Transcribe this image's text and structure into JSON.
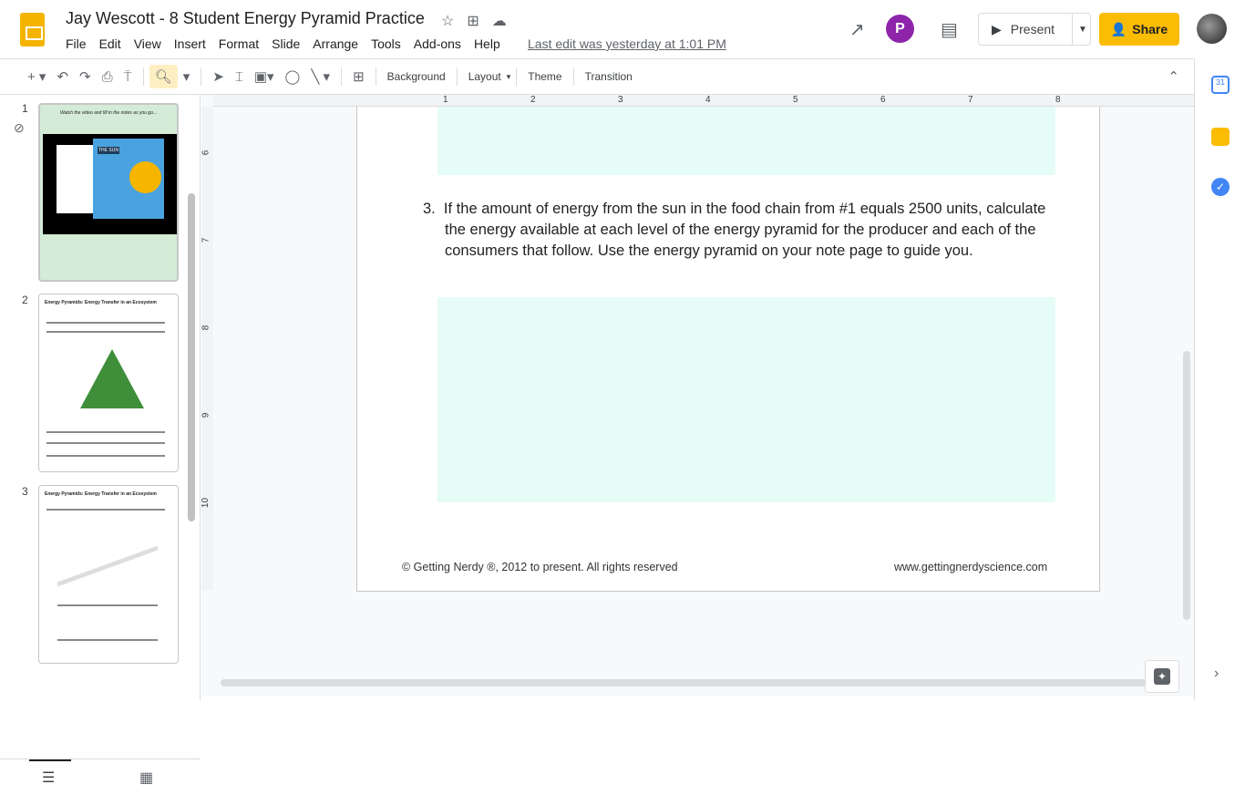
{
  "header": {
    "title": "Jay Wescott - 8 Student Energy Pyramid Practice",
    "last_edit": "Last edit was yesterday at 1:01 PM",
    "present": "Present",
    "share": "Share"
  },
  "menu": [
    "File",
    "Edit",
    "View",
    "Insert",
    "Format",
    "Slide",
    "Arrange",
    "Tools",
    "Add-ons",
    "Help"
  ],
  "toolbar": {
    "background": "Background",
    "layout": "Layout",
    "theme": "Theme",
    "transition": "Transition"
  },
  "slides": [
    {
      "number": "1",
      "heading": "Watch the video and fill in the notes as you go...",
      "label": "THE SUN"
    },
    {
      "number": "2",
      "heading": "Energy Pyramids: Energy Transfer in an Ecosystem"
    },
    {
      "number": "3",
      "heading": "Energy Pyramids: Energy Transfer in an Ecosystem"
    }
  ],
  "ruler": {
    "h": [
      "1",
      "2",
      "3",
      "4",
      "5",
      "6",
      "7",
      "8"
    ],
    "v": [
      "6",
      "7",
      "8",
      "9",
      "10"
    ]
  },
  "slide": {
    "question": "3.  If the amount of energy from the sun in the food chain from #1 equals 2500 units, calculate the energy available at each level of the energy pyramid for the producer and each of the consumers that follow.  Use the energy pyramid on your note page to guide you.",
    "footer_left": "© Getting Nerdy ®, 2012 to present. All rights reserved",
    "footer_right": "www.gettingnerdyscience.com"
  },
  "colors": {
    "answer_box": "#e6fcf6",
    "share": "#fbbc04"
  }
}
